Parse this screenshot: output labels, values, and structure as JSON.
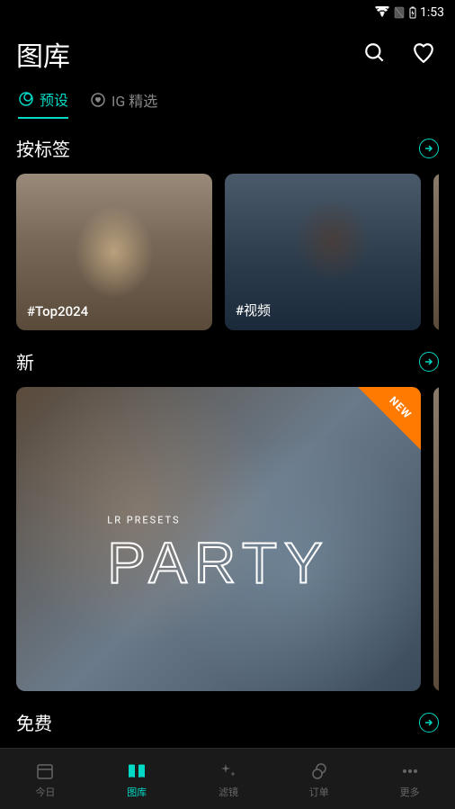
{
  "status_bar": {
    "time": "1:53"
  },
  "header": {
    "title": "图库"
  },
  "tabs": [
    {
      "label": "预设",
      "active": true
    },
    {
      "label": "IG 精选",
      "active": false
    }
  ],
  "sections": {
    "by_tag": {
      "title": "按标签",
      "items": [
        {
          "label": "#Top2024"
        },
        {
          "label": "#视频"
        },
        {
          "label": "#"
        }
      ]
    },
    "new": {
      "title": "新",
      "items": [
        {
          "subtitle": "LR PRESETS",
          "title": "PARTY",
          "badge": "NEW"
        }
      ]
    },
    "free": {
      "title": "免费"
    }
  },
  "bottom_nav": [
    {
      "label": "今日",
      "active": false
    },
    {
      "label": "图库",
      "active": true
    },
    {
      "label": "滤镜",
      "active": false
    },
    {
      "label": "订单",
      "active": false
    },
    {
      "label": "更多",
      "active": false
    }
  ],
  "colors": {
    "accent": "#00d9c5",
    "new_badge": "#ff7a00"
  }
}
